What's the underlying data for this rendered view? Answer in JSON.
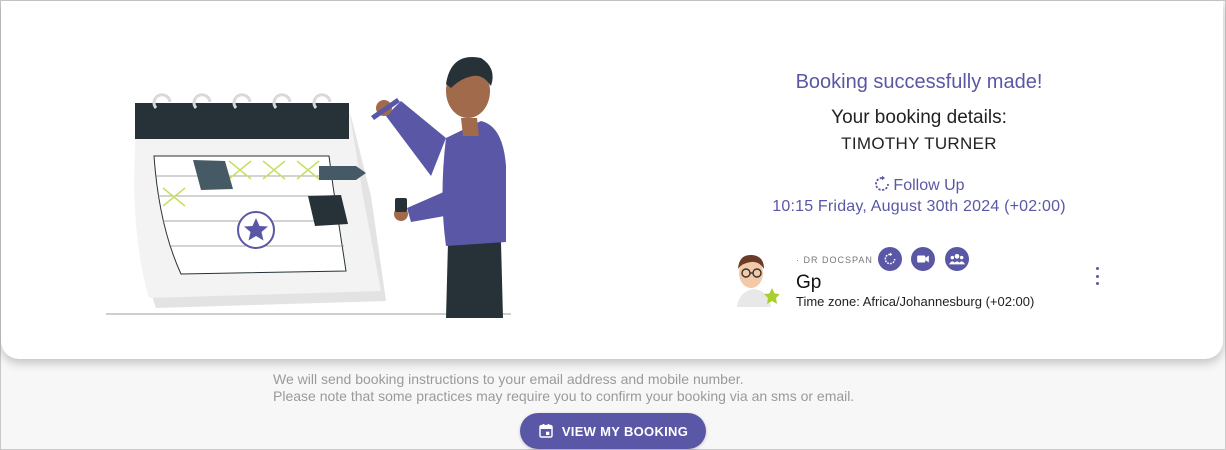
{
  "booking": {
    "title": "Booking successfully made!",
    "details_label": "Your booking details:",
    "patient_name": "TIMOTHY TURNER",
    "appointment_type": "Follow Up",
    "datetime": "10:15 Friday, August 30th 2024 (+02:00)"
  },
  "provider": {
    "kicker": "· DR DOCSPAN",
    "name": "Gp",
    "timezone": "Time zone: Africa/Johannesburg (+02:00)",
    "icons": [
      "follow-up-icon",
      "video-icon",
      "group-icon",
      "more-vert-icon"
    ]
  },
  "footer": {
    "note_line1": "We will send booking instructions to your email address and mobile number.",
    "note_line2": "Please note that some practices may require you to confirm your booking via an sms or email.",
    "view_button_label": "VIEW MY BOOKING"
  },
  "colors": {
    "accent": "#5a57a6",
    "calendar_dark": "#263238",
    "highlight": "#c5e063"
  }
}
